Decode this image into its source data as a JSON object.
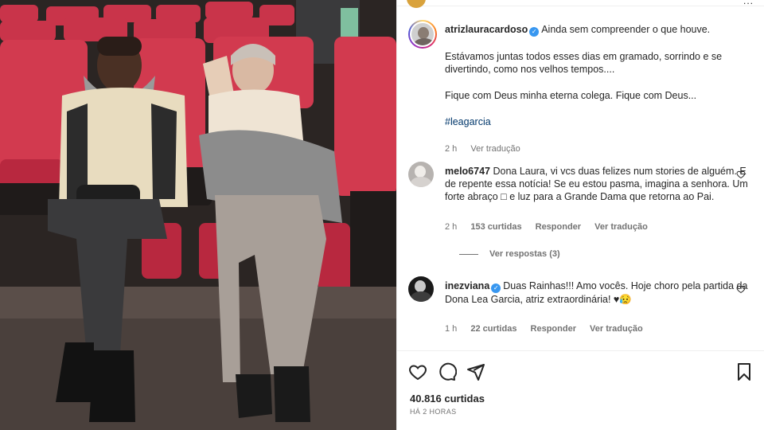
{
  "post": {
    "header": {
      "more_label": "..."
    },
    "caption": {
      "username": "atrizlauracardoso",
      "lines": [
        "Ainda sem compreender o que houve.",
        "Estávamos juntas todos esses dias em gramado, sorrindo e se divertindo, como nos velhos tempos....",
        "Fique com Deus minha eterna colega. Fique com Deus...",
        "#leagarcia"
      ],
      "time": "2 h",
      "translate": "Ver tradução"
    },
    "comments": [
      {
        "username": "melo6747",
        "verified": false,
        "text": "Dona Laura, vi vcs duas felizes num stories de alguém. E de repente essa notícia! Se eu estou pasma, imagina a senhora. Um forte abraço □ e luz para a Grande Dama que retorna ao Pai.",
        "time": "2 h",
        "likes": "153 curtidas",
        "reply": "Responder",
        "translate": "Ver tradução",
        "view_replies": "Ver respostas (3)"
      },
      {
        "username": "inezviana",
        "verified": true,
        "text": "Duas Rainhas!!! Amo vocês. Hoje choro pela partida da Dona Lea Garcia, atriz extraordinária! ♥😥",
        "time": "1 h",
        "likes": "22 curtidas",
        "reply": "Responder",
        "translate": "Ver tradução"
      }
    ],
    "footer": {
      "likes": "40.816 curtidas",
      "time": "HÁ 2 HORAS"
    }
  },
  "colors": {
    "link": "#00376b",
    "verified": "#3897f0",
    "muted": "#737373"
  },
  "icons": [
    "like-icon",
    "comment-icon",
    "share-icon",
    "save-icon",
    "heart-icon",
    "verified-badge-icon"
  ]
}
